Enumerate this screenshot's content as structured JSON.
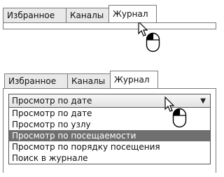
{
  "top_panel": {
    "tabs": [
      {
        "label": "Избранное"
      },
      {
        "label": "Каналы"
      },
      {
        "label": "Журнал"
      }
    ],
    "active_tab": "Журнал"
  },
  "bottom_panel": {
    "tabs": [
      {
        "label": "Избранное"
      },
      {
        "label": "Каналы"
      },
      {
        "label": "Журнал"
      }
    ],
    "active_tab": "Журнал",
    "dropdown": {
      "selected": "Просмотр по дате",
      "options": [
        {
          "label": "Просмотр по дате"
        },
        {
          "label": "Просмотр по узлу"
        },
        {
          "label": "Просмотр по посещаемости"
        },
        {
          "label": "Просмотр по порядку посещения"
        },
        {
          "label": "Поиск в журнале"
        }
      ],
      "highlighted_option": "Просмотр по посещаемости"
    }
  },
  "icons": {
    "pointer": "arrow-cursor-icon",
    "mouse": "mouse-left-click-icon",
    "dropdown_arrow": "triangle-down-icon"
  }
}
